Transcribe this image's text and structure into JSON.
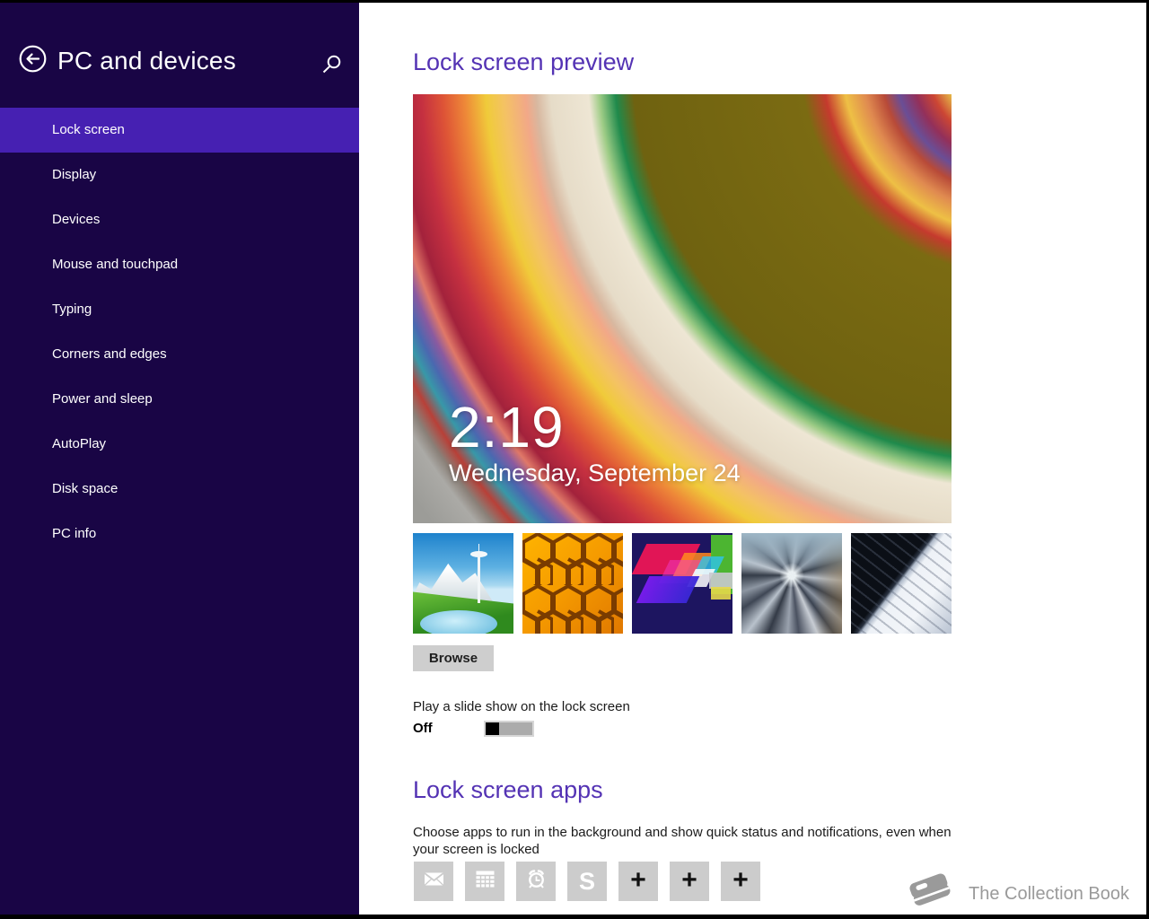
{
  "sidebar": {
    "title": "PC and devices",
    "items": [
      {
        "label": "Lock screen",
        "selected": true
      },
      {
        "label": "Display",
        "selected": false
      },
      {
        "label": "Devices",
        "selected": false
      },
      {
        "label": "Mouse and touchpad",
        "selected": false
      },
      {
        "label": "Typing",
        "selected": false
      },
      {
        "label": "Corners and edges",
        "selected": false
      },
      {
        "label": "Power and sleep",
        "selected": false
      },
      {
        "label": "AutoPlay",
        "selected": false
      },
      {
        "label": "Disk space",
        "selected": false
      },
      {
        "label": "PC info",
        "selected": false
      }
    ],
    "icons": {
      "back": "back-arrow-icon",
      "search": "search-icon"
    }
  },
  "main": {
    "preview": {
      "heading": "Lock screen preview",
      "clock_time": "2:19",
      "clock_date": "Wednesday, September 24"
    },
    "thumbnails": [
      "seattle-space-needle",
      "honeycomb",
      "colorful-diamonds",
      "train-tunnel",
      "piano-keys"
    ],
    "browse_label": "Browse",
    "slideshow": {
      "label": "Play a slide show on the lock screen",
      "state": "Off"
    },
    "apps": {
      "heading": "Lock screen apps",
      "description": "Choose apps to run in the background and show quick status and notifications, even when your screen is locked",
      "slots": [
        "mail-icon",
        "calendar-icon",
        "alarm-clock-icon",
        "skype-icon",
        "add-app",
        "add-app",
        "add-app"
      ],
      "add_label": "+",
      "skype_letter": "S"
    },
    "watermark": {
      "label": "The Collection Book",
      "icon": "book-icon"
    }
  },
  "colors": {
    "sidebar_bg": "#190545",
    "sidebar_selected": "#4620b2",
    "heading_purple": "#5433b4",
    "tile_gray": "#cccccc",
    "watermark_gray": "#9a9a9a",
    "toggle_track": "#ababab",
    "toggle_thumb": "#000000"
  }
}
